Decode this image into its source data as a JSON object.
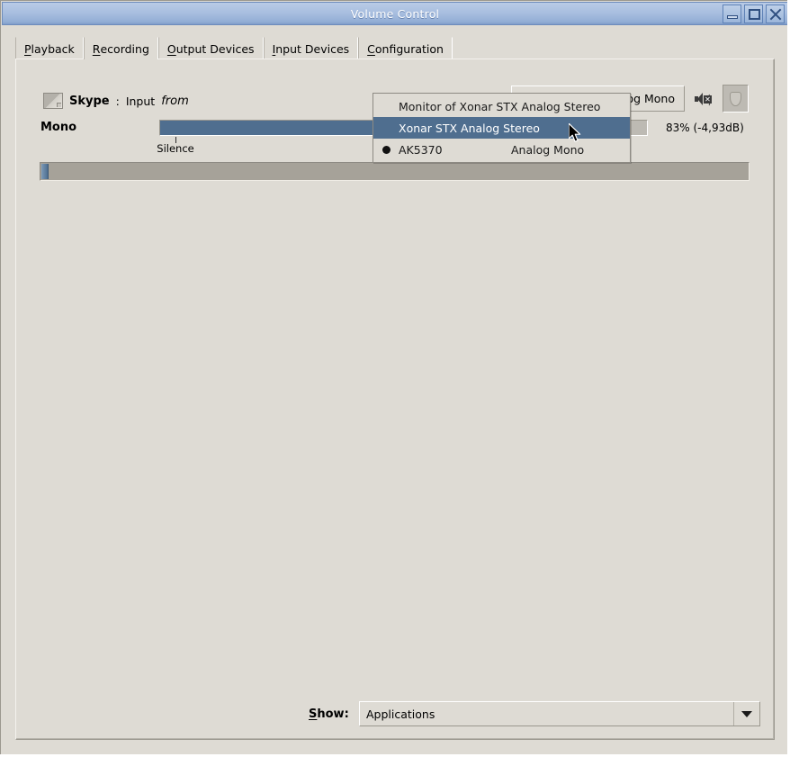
{
  "window": {
    "title": "Volume Control",
    "buttons": {
      "minimize": "minimize",
      "maximize": "maximize",
      "close": "close"
    }
  },
  "tabs": [
    {
      "label": "Playback",
      "mnemonic": "P",
      "rest": "layback",
      "active": false
    },
    {
      "label": "Recording",
      "mnemonic": "R",
      "rest": "ecording",
      "active": true
    },
    {
      "label": "Output Devices",
      "mnemonic": "O",
      "rest": "utput Devices",
      "active": false
    },
    {
      "label": "Input Devices",
      "mnemonic": "I",
      "rest": "nput Devices",
      "active": false
    },
    {
      "label": "Configuration",
      "mnemonic": "C",
      "rest": "onfiguration",
      "active": false
    }
  ],
  "stream": {
    "icon": "application-icon",
    "app_name": "Skype",
    "separator": ":",
    "role": "Input",
    "from_label": "from",
    "device_combo_value": "og Mono",
    "mute_icon": "speaker-muted-icon",
    "lock_icon": "shield-icon"
  },
  "channel": {
    "name": "Mono",
    "tick_label": "Silence",
    "volume_percent": 83,
    "volume_text": "83% (-4,93dB)",
    "meter_percent": 1
  },
  "menu": {
    "items": [
      {
        "label": "Monitor of Xonar STX Analog Stereo",
        "selected": false,
        "highlighted": false,
        "two_column": false
      },
      {
        "label": "Xonar STX Analog Stereo",
        "selected": false,
        "highlighted": true,
        "two_column": false
      },
      {
        "label": "AK5370        Analog Mono",
        "selected": true,
        "highlighted": false,
        "two_column": true,
        "col1": "AK5370",
        "col2": "Analog Mono"
      }
    ]
  },
  "footer": {
    "show_label_mnemonic": "S",
    "show_label_rest": "how:",
    "show_value": "Applications"
  },
  "colors": {
    "titlebar_from": "#b9cbe6",
    "titlebar_to": "#7e9cc9",
    "window_bg": "#dedbd4",
    "accent": "#4f6e8f",
    "meter_bg": "#a6a299"
  }
}
